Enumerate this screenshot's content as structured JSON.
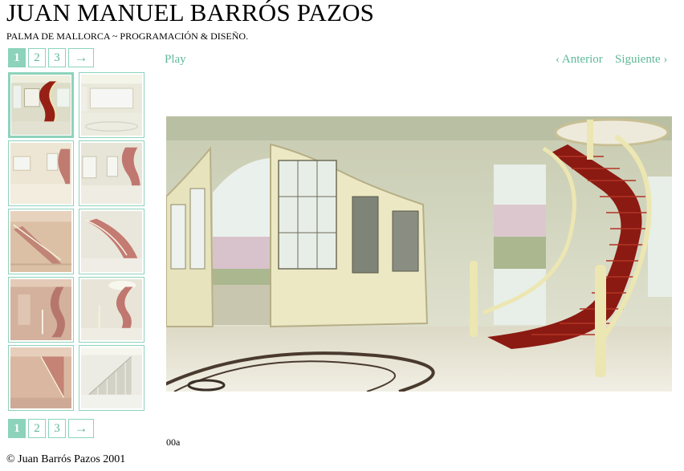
{
  "header": {
    "title": "JUAN MANUEL BARRÓS PAZOS",
    "subtitle": "PALMA DE MALLORCA ~ PROGRAMACIÓN & DISEÑO."
  },
  "pager": {
    "pages": [
      "1",
      "2",
      "3"
    ],
    "next_arrow": "→",
    "active_page": "1"
  },
  "controls": {
    "play": "Play",
    "previous": "‹ Anterior",
    "next": "Siguiente ›"
  },
  "image": {
    "caption": "00a"
  },
  "footer": {
    "copyright": "© Juan Barrós Pazos 2001"
  },
  "colors": {
    "accent": "#8dd3bb",
    "link": "#5fb898",
    "stair_red": "#8b1a12",
    "railing": "#ece6b2"
  },
  "thumbnails": [
    "thumb-01",
    "thumb-02",
    "thumb-03",
    "thumb-04",
    "thumb-05",
    "thumb-06",
    "thumb-07",
    "thumb-08",
    "thumb-09",
    "thumb-10"
  ]
}
